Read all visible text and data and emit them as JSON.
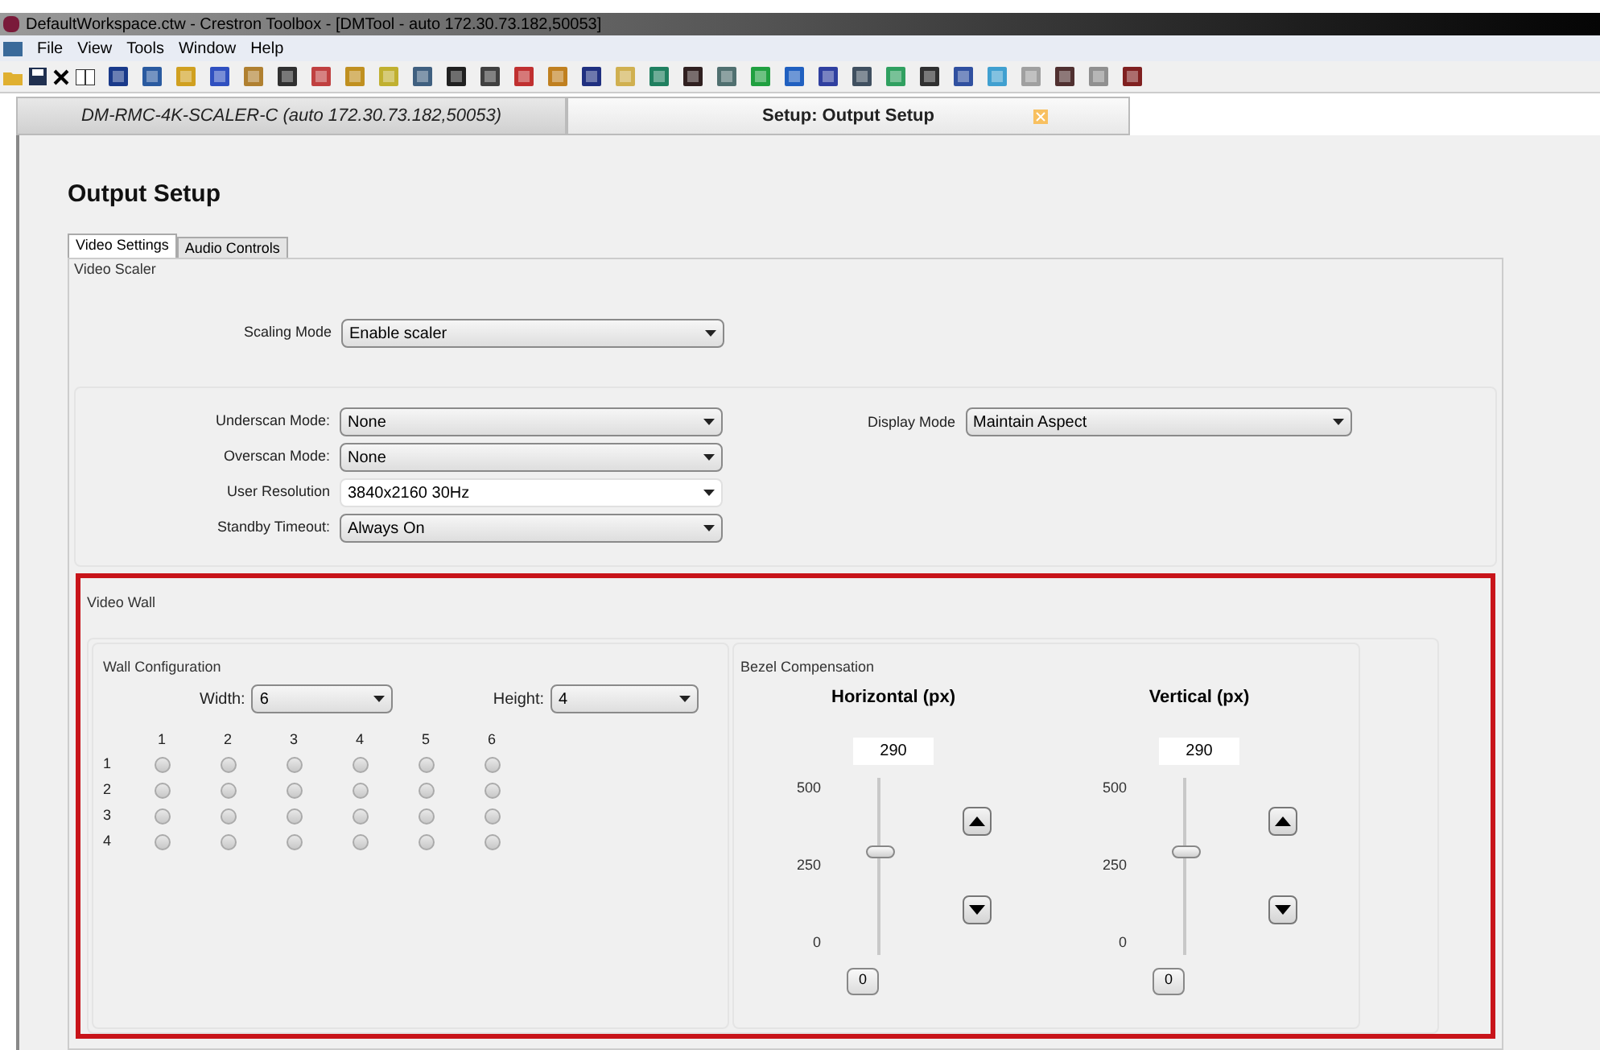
{
  "window": {
    "title": "DefaultWorkspace.ctw - Crestron Toolbox - [DMTool - auto 172.30.73.182,50053]"
  },
  "menu": [
    "File",
    "View",
    "Tools",
    "Window",
    "Help"
  ],
  "doc_tabs": [
    {
      "label": "DM-RMC-4K-SCALER-C (auto  172.30.73.182,50053)",
      "selected": false
    },
    {
      "label": "Setup: Output Setup",
      "selected": true
    }
  ],
  "page_title": "Output Setup",
  "tabs": [
    {
      "label": "Video Settings",
      "selected": true
    },
    {
      "label": "Audio Controls",
      "selected": false
    }
  ],
  "video_scaler": {
    "legend": "Video Scaler",
    "scaling_mode": {
      "label": "Scaling Mode",
      "value": "Enable scaler"
    },
    "left_fields": [
      {
        "label": "Underscan Mode:",
        "value": "None",
        "kind": "combo"
      },
      {
        "label": "Overscan Mode:",
        "value": "None",
        "kind": "combo"
      },
      {
        "label": "User Resolution",
        "value": "3840x2160 30Hz",
        "kind": "editable"
      },
      {
        "label": "Standby Timeout:",
        "value": "Always On",
        "kind": "combo"
      }
    ],
    "display_mode": {
      "label": "Display Mode",
      "value": "Maintain Aspect"
    }
  },
  "video_wall": {
    "legend": "Video Wall",
    "wall_configuration": {
      "legend": "Wall Configuration",
      "width": {
        "label": "Width:",
        "value": "6"
      },
      "height": {
        "label": "Height:",
        "value": "4"
      },
      "columns": [
        "1",
        "2",
        "3",
        "4",
        "5",
        "6"
      ],
      "rows": [
        {
          "label": "1",
          "cells": [
            {
              "selected": false
            },
            {
              "selected": false
            },
            {
              "selected": false
            },
            {
              "selected": false
            },
            {
              "selected": false
            },
            {
              "selected": false
            }
          ]
        },
        {
          "label": "2",
          "cells": [
            {
              "selected": false
            },
            {
              "selected": false
            },
            {
              "selected": false
            },
            {
              "selected": false
            },
            {
              "selected": false
            },
            {
              "selected": false
            }
          ]
        },
        {
          "label": "3",
          "cells": [
            {
              "selected": false
            },
            {
              "selected": false
            },
            {
              "selected": false
            },
            {
              "selected": false
            },
            {
              "selected": false
            },
            {
              "selected": false
            }
          ]
        },
        {
          "label": "4",
          "cells": [
            {
              "selected": false
            },
            {
              "selected": false
            },
            {
              "selected": false
            },
            {
              "selected": false
            },
            {
              "selected": false
            },
            {
              "selected": false
            }
          ]
        }
      ]
    },
    "bezel_compensation": {
      "legend": "Bezel Compensation",
      "sliders": [
        {
          "title": "Horizontal (px)",
          "value": "290",
          "max_label": "500",
          "mid_label": "250",
          "min_label": "0",
          "level": 0.58,
          "reset": "0"
        },
        {
          "title": "Vertical (px)",
          "value": "290",
          "max_label": "500",
          "mid_label": "250",
          "min_label": "0",
          "level": 0.58,
          "reset": "0"
        }
      ]
    }
  }
}
